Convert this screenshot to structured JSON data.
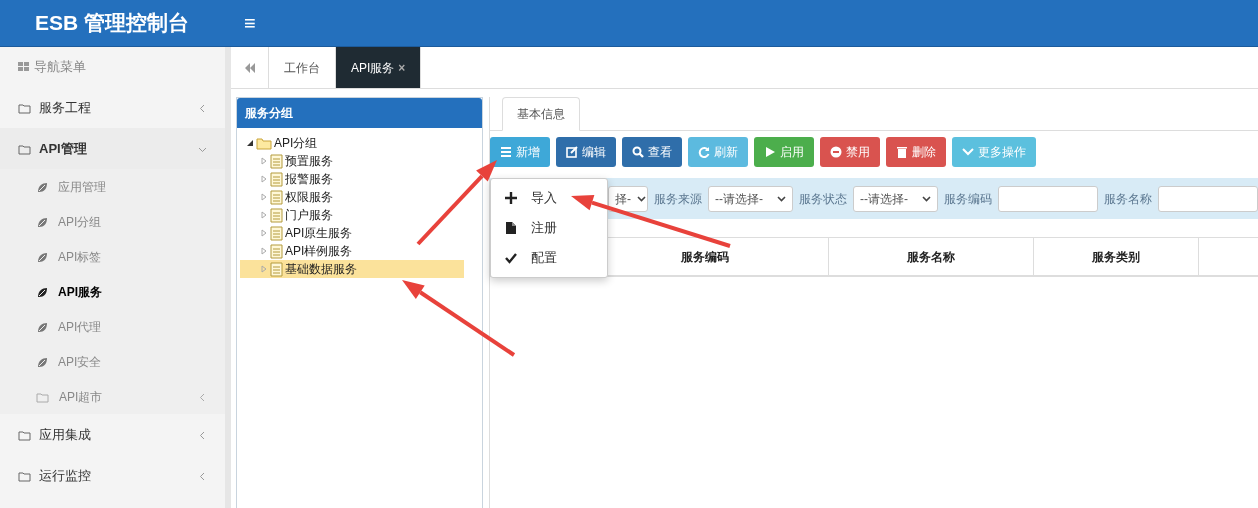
{
  "header": {
    "title": "ESB 管理控制台",
    "menu_icon": "≡"
  },
  "sidebar": {
    "heading": "导航菜单",
    "items": [
      {
        "label": "服务工程",
        "expanded": false
      },
      {
        "label": "API管理",
        "expanded": true,
        "children": [
          {
            "label": "应用管理",
            "kind": "leaf",
            "selected": false
          },
          {
            "label": "API分组",
            "kind": "leaf",
            "selected": false
          },
          {
            "label": "API标签",
            "kind": "leaf",
            "selected": false
          },
          {
            "label": "API服务",
            "kind": "leaf",
            "selected": true
          },
          {
            "label": "API代理",
            "kind": "leaf",
            "selected": false
          },
          {
            "label": "API安全",
            "kind": "leaf",
            "selected": false
          },
          {
            "label": "API超市",
            "kind": "folder",
            "selected": false,
            "expanded": false
          }
        ]
      },
      {
        "label": "应用集成",
        "expanded": false
      },
      {
        "label": "运行监控",
        "expanded": false
      }
    ]
  },
  "tabs": [
    {
      "label": "工作台",
      "selected": false
    },
    {
      "label": "API服务",
      "selected": true,
      "close": "×"
    }
  ],
  "tree": {
    "title": "服务分组",
    "root": {
      "label": "API分组",
      "expanded": true,
      "children": [
        {
          "label": "预置服务",
          "selected": false
        },
        {
          "label": "报警服务",
          "selected": false
        },
        {
          "label": "权限服务",
          "selected": false
        },
        {
          "label": "门户服务",
          "selected": false
        },
        {
          "label": "API原生服务",
          "selected": false
        },
        {
          "label": "API样例服务",
          "selected": false
        },
        {
          "label": "基础数据服务",
          "selected": true
        }
      ]
    }
  },
  "detail_tabs": [
    {
      "label": "基本信息",
      "selected": true
    }
  ],
  "toolbar": [
    {
      "label": "新增",
      "kind": "add",
      "color": "#3ea8d8"
    },
    {
      "label": "编辑",
      "kind": "edit",
      "color": "#2f6eaa"
    },
    {
      "label": "查看",
      "kind": "view",
      "color": "#2f6eaa"
    },
    {
      "label": "刷新",
      "kind": "refresh",
      "color": "#5cbadf"
    },
    {
      "label": "启用",
      "kind": "enable",
      "color": "#4cae4c"
    },
    {
      "label": "禁用",
      "kind": "disable",
      "color": "#d9534f"
    },
    {
      "label": "删除",
      "kind": "delete",
      "color": "#d9534f"
    },
    {
      "label": "更多操作",
      "kind": "more",
      "color": "#5bc0de"
    }
  ],
  "dropdown_menu": [
    {
      "label": "导入",
      "kind": "plus"
    },
    {
      "label": "注册",
      "kind": "file"
    },
    {
      "label": "配置",
      "kind": "check"
    }
  ],
  "filters": [
    {
      "kind": "select",
      "value": "择-"
    },
    {
      "kind": "select",
      "label": "服务来源",
      "value": "--请选择-"
    },
    {
      "kind": "select",
      "label": "服务状态",
      "value": "--请选择-"
    },
    {
      "kind": "text",
      "label": "服务编码"
    },
    {
      "kind": "text",
      "label": "服务名称"
    }
  ],
  "table": {
    "columns": [
      "服务编码",
      "服务名称",
      "服务类别"
    ]
  }
}
